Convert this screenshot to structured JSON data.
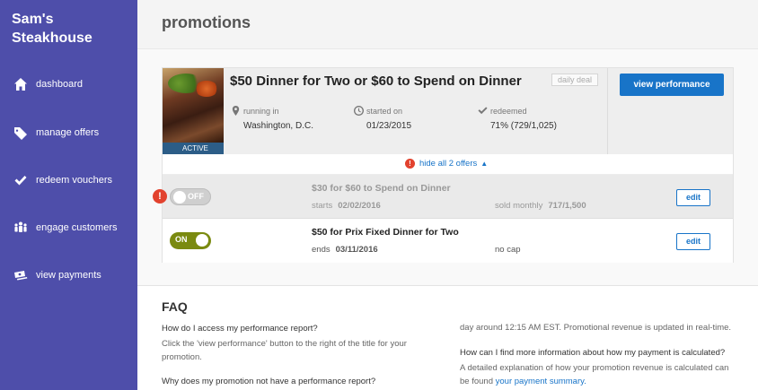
{
  "sidebar": {
    "brand_line1": "Sam's",
    "brand_line2": "Steakhouse",
    "items": [
      {
        "label": "dashboard",
        "icon": "home-icon"
      },
      {
        "label": "manage offers",
        "icon": "tag-icon"
      },
      {
        "label": "redeem vouchers",
        "icon": "check-icon"
      },
      {
        "label": "engage customers",
        "icon": "people-icon"
      },
      {
        "label": "view payments",
        "icon": "money-icon"
      }
    ],
    "bg_color": "#4e4eaa"
  },
  "header": {
    "title": "promotions"
  },
  "promotion": {
    "title": "$50 Dinner for Two or $60 to Spend on Dinner",
    "badge": "daily deal",
    "status": "ACTIVE",
    "running_in_label": "running in",
    "running_in_value": "Washington, D.C.",
    "started_on_label": "started on",
    "started_on_value": "01/23/2015",
    "redeemed_label": "redeemed",
    "redeemed_value": "71% (729/1,025)",
    "view_performance_label": "view performance",
    "hide_offers_label": "hide all 2 offers"
  },
  "offers": [
    {
      "toggle": "OFF",
      "name": "$30 for $60 to Spend on Dinner",
      "date_label": "starts",
      "date_value": "02/02/2016",
      "cap_label": "sold monthly",
      "cap_value": "717/1,500",
      "edit_label": "edit"
    },
    {
      "toggle": "ON",
      "name": "$50 for Prix Fixed Dinner for Two",
      "date_label": "ends",
      "date_value": "03/11/2016",
      "cap_label": "no cap",
      "cap_value": "",
      "edit_label": "edit"
    }
  ],
  "faq": {
    "heading": "FAQ",
    "q1": "How do I access my performance report?",
    "a1_line1": "Click the 'view performance' button to the right of the title for your",
    "a1_line2": "promotion.",
    "q2": "Why does my promotion not have a performance report?",
    "right_a0": "day around 12:15 AM EST. Promotional revenue is updated in real-time.",
    "q3": "How can I find more information about how my payment is calculated?",
    "a3_line1": "A detailed explanation of how your promotion revenue is calculated can",
    "a3_line2_prefix": "be found",
    "a3_link": "your payment summary."
  },
  "colors": {
    "accent": "#1874c8",
    "toggle_on": "#7a8a10",
    "alert": "#e2422e"
  }
}
